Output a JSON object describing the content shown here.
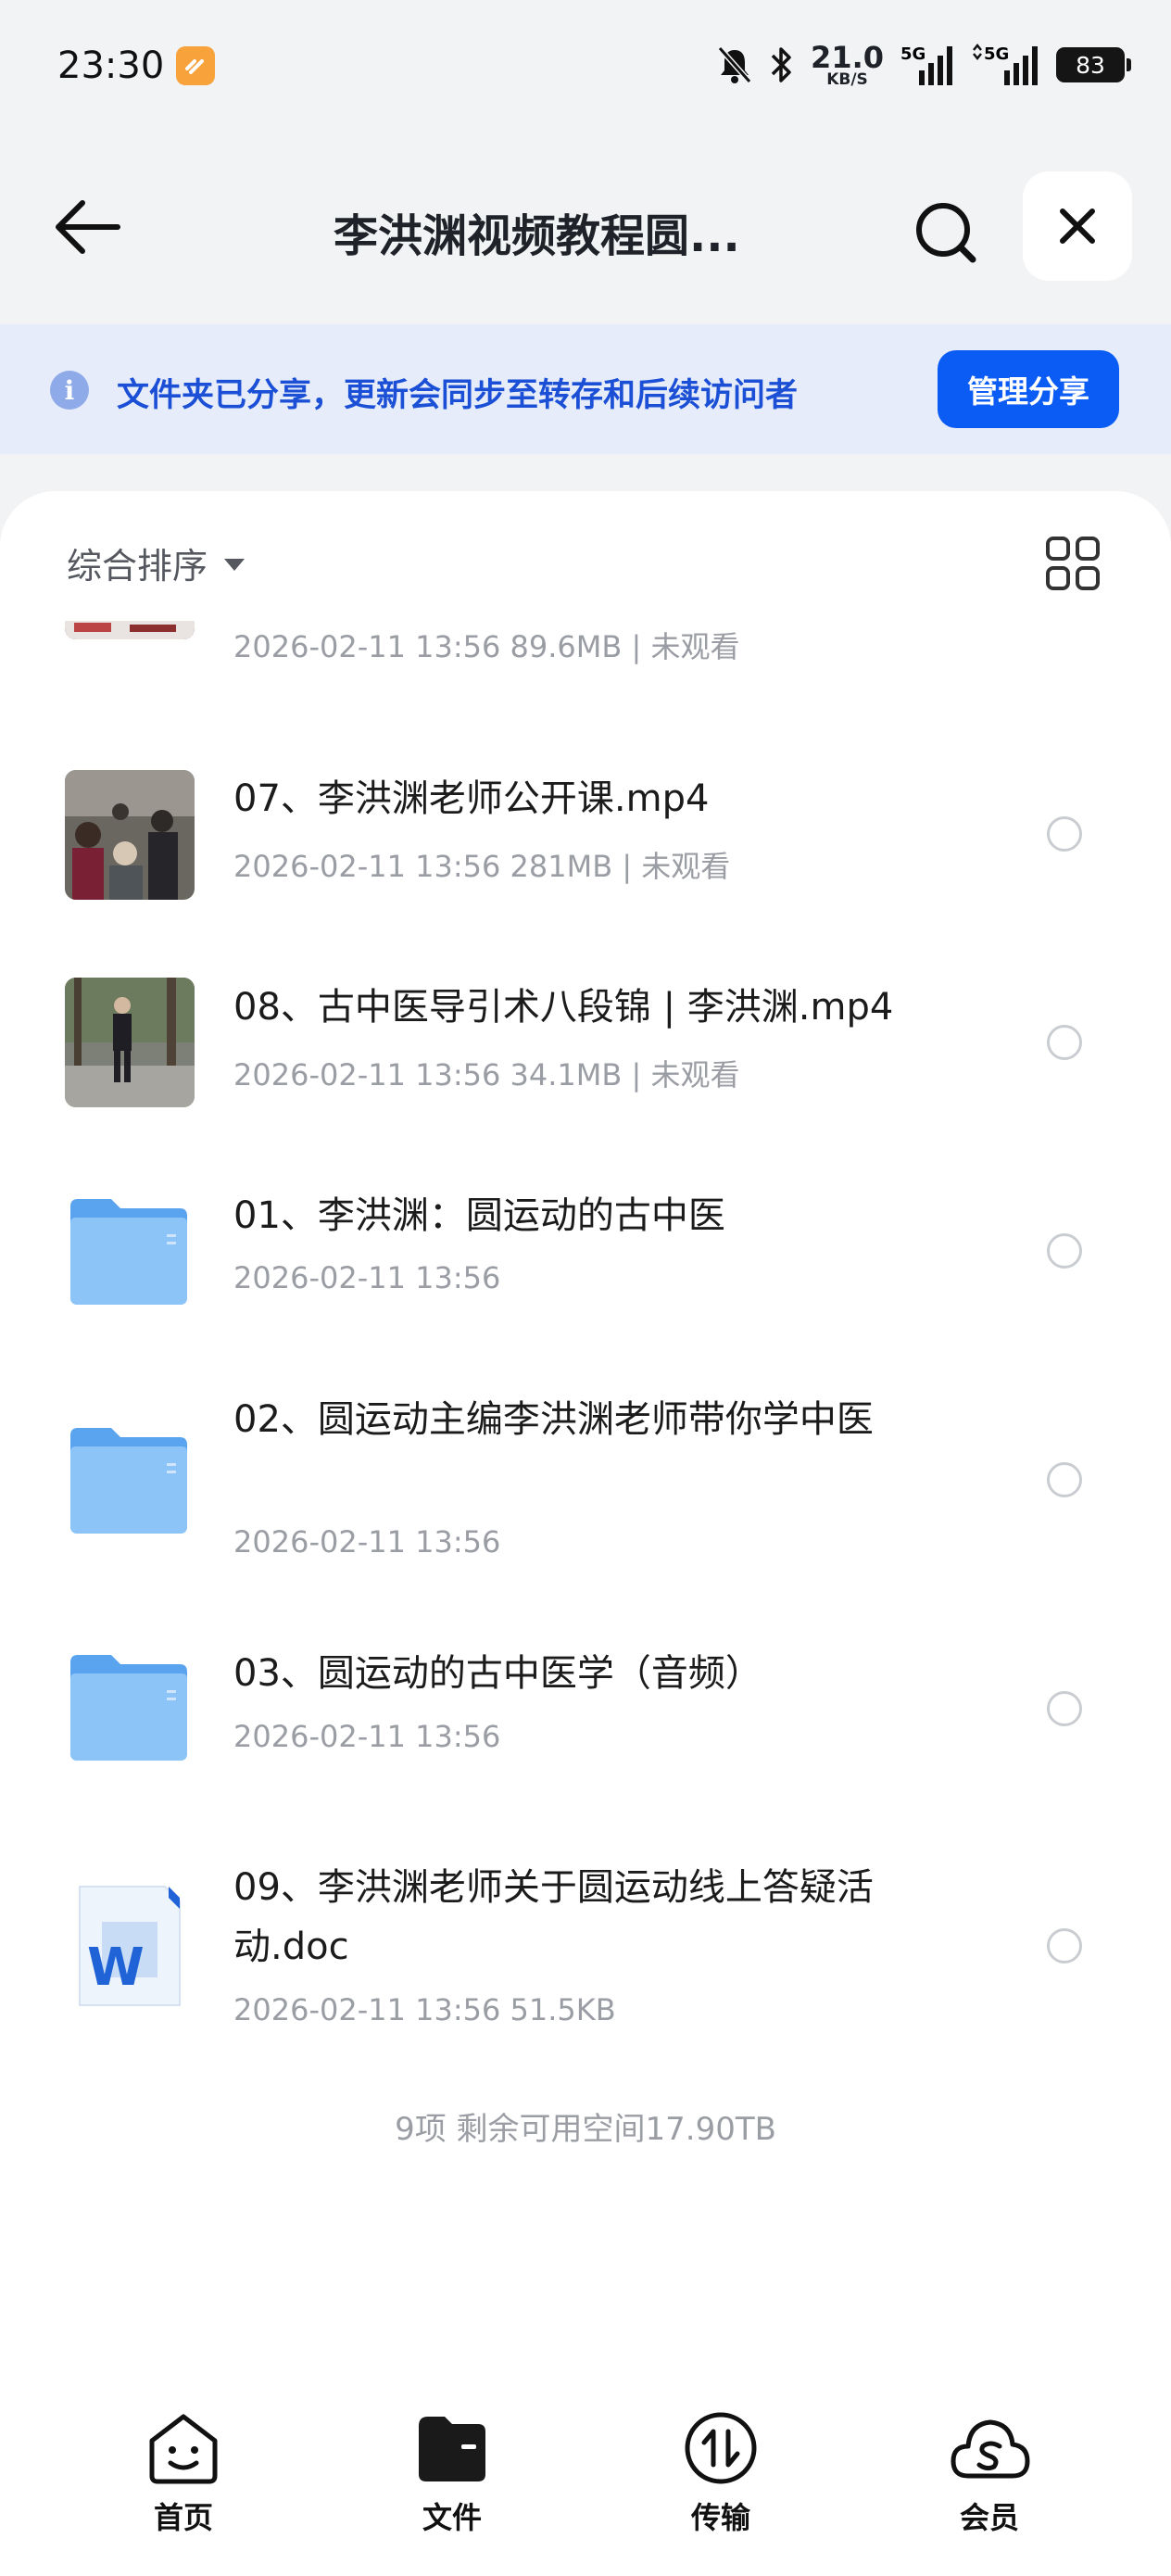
{
  "status_bar": {
    "time": "23:30",
    "net_speed": "21.0",
    "net_unit": "KB/S",
    "signal_1": "5G",
    "signal_2": "5G",
    "battery": "83"
  },
  "header": {
    "title": "李洪渊视频教程圆..."
  },
  "banner": {
    "text": "文件夹已分享，更新会同步至转存和后续访问者",
    "button": "管理分享",
    "info_glyph": "i"
  },
  "toolbar": {
    "sort_label": "综合排序"
  },
  "files": [
    {
      "kind": "video",
      "name": "",
      "meta": "2026-02-11 13:56  89.6MB | 未观看"
    },
    {
      "kind": "video",
      "name": "07、李洪渊老师公开课.mp4",
      "meta": "2026-02-11 13:56  281MB | 未观看"
    },
    {
      "kind": "video",
      "name": "08、古中医导引术八段锦 | 李洪渊.mp4",
      "meta": "2026-02-11 13:56  34.1MB | 未观看"
    },
    {
      "kind": "folder",
      "name": "01、李洪渊：圆运动的古中医",
      "meta": "2026-02-11 13:56"
    },
    {
      "kind": "folder",
      "name": "02、圆运动主编李洪渊老师带你学中医",
      "meta": "2026-02-11 13:56"
    },
    {
      "kind": "folder",
      "name": "03、圆运动的古中医学（音频）",
      "meta": "2026-02-11 13:56"
    },
    {
      "kind": "doc",
      "name": "09、李洪渊老师关于圆运动线上答疑活动.doc",
      "meta": "2026-02-11 13:56  51.5KB"
    }
  ],
  "summary": "9项 剩余可用空间17.90TB",
  "nav": {
    "home": "首页",
    "files": "文件",
    "transfer": "传输",
    "vip": "会员"
  },
  "colors": {
    "accent": "#0b5cf5",
    "banner_bg": "#e6ecfa",
    "banner_text": "#1a4fd6",
    "folder": "#7ab8f5"
  }
}
